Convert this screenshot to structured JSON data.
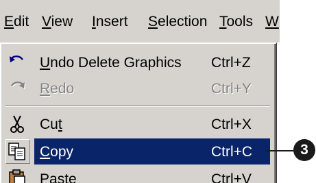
{
  "menubar": {
    "items": [
      {
        "label": "Edit",
        "mnemonic": "E",
        "rest": "dit"
      },
      {
        "label": "View",
        "mnemonic": "V",
        "rest": "iew"
      },
      {
        "label": "Insert",
        "mnemonic": "I",
        "rest": "nsert"
      },
      {
        "label": "Selection",
        "mnemonic": "S",
        "rest": "election"
      },
      {
        "label": "Tools",
        "mnemonic": "T",
        "rest": "ools"
      },
      {
        "label": "W",
        "mnemonic": "W",
        "rest": ""
      }
    ]
  },
  "edit_menu": {
    "items": [
      {
        "pre": "",
        "mnemonic": "U",
        "post": "ndo Delete Graphics",
        "shortcut": "Ctrl+Z",
        "icon": "undo-icon",
        "enabled": true
      },
      {
        "pre": "",
        "mnemonic": "R",
        "post": "edo",
        "shortcut": "Ctrl+Y",
        "icon": "redo-icon",
        "enabled": false
      },
      {
        "pre": "Cu",
        "mnemonic": "t",
        "post": "",
        "shortcut": "Ctrl+X",
        "icon": "scissors-icon",
        "enabled": true
      },
      {
        "pre": "",
        "mnemonic": "C",
        "post": "opy",
        "shortcut": "Ctrl+C",
        "icon": "copy-icon",
        "enabled": true,
        "highlighted": true
      },
      {
        "pre": "",
        "mnemonic": "P",
        "post": "aste",
        "shortcut": "Ctrl+V",
        "icon": "paste-icon",
        "enabled": true
      }
    ]
  },
  "callout": {
    "number": "3"
  },
  "colors": {
    "menu_background": "#d6d3ce",
    "highlight": "#0a246a",
    "disabled_text": "#848284",
    "callout": "#1a1a1a"
  }
}
